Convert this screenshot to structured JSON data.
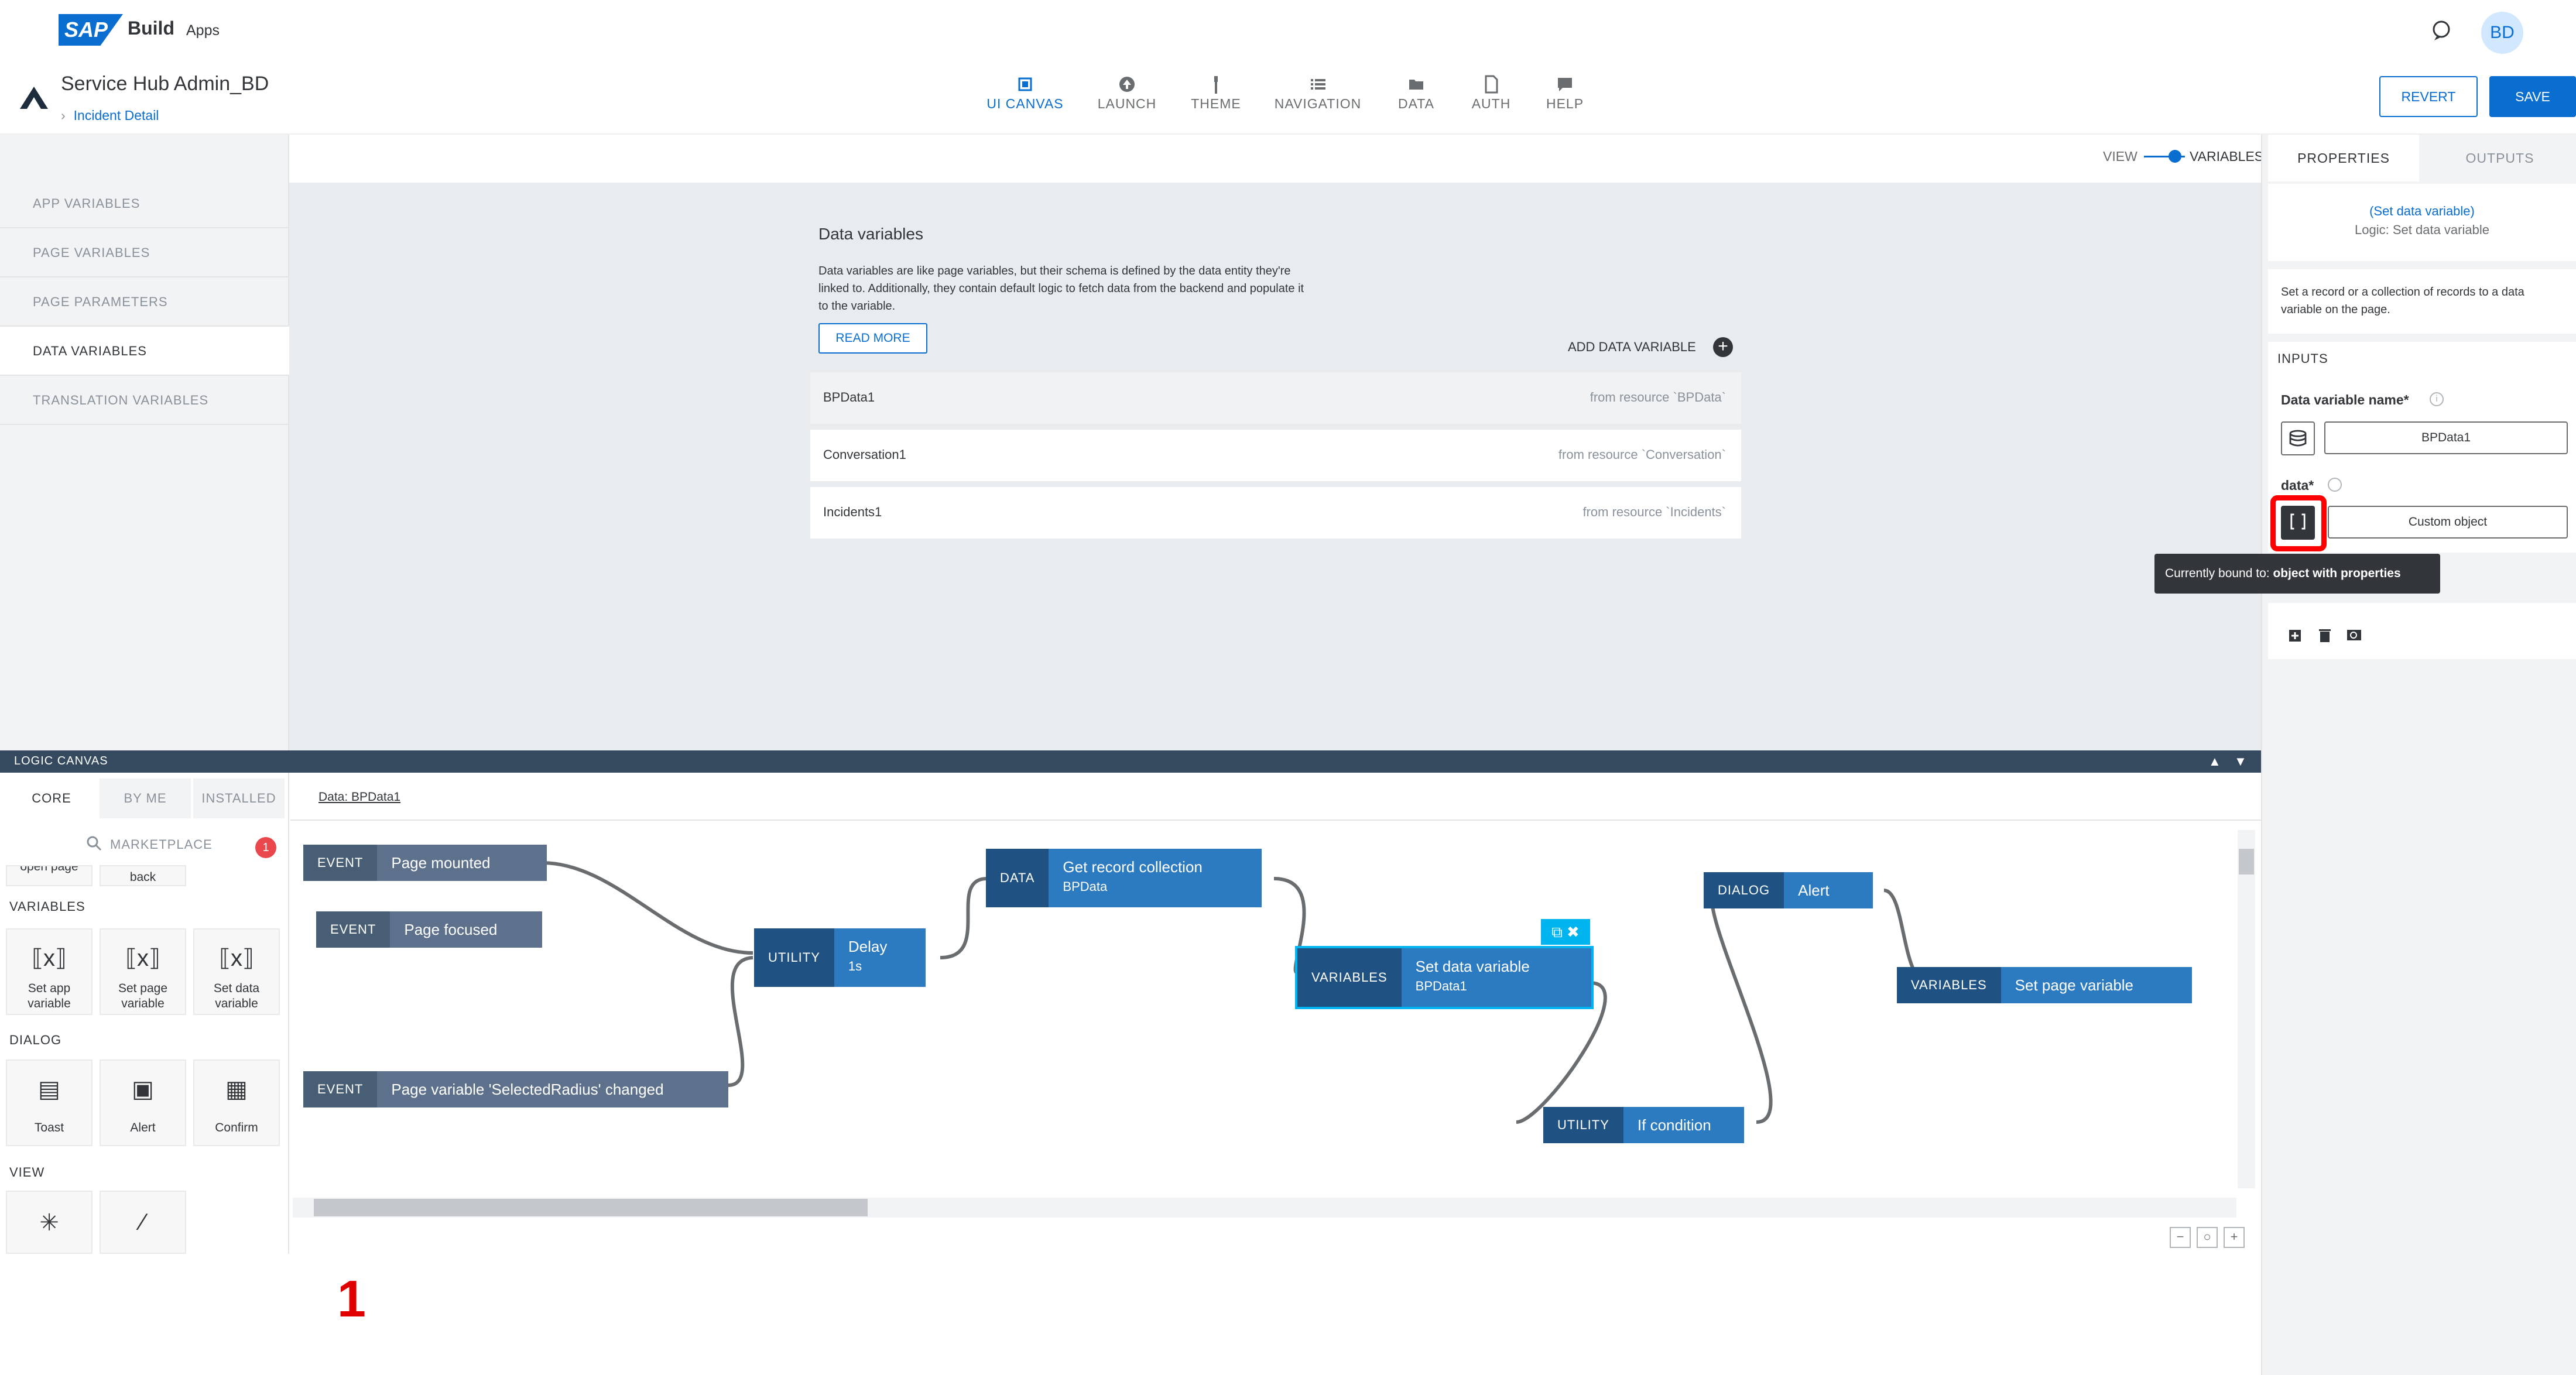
{
  "shell": {
    "brand_logo": "SAP",
    "brand_build": "Build",
    "brand_apps": "Apps",
    "avatar_initials": "BD"
  },
  "app": {
    "title": "Service Hub Admin_BD",
    "breadcrumb": "Incident Detail"
  },
  "nav_tabs": [
    {
      "label": "UI CANVAS",
      "icon": "canvas-icon",
      "active": true
    },
    {
      "label": "LAUNCH",
      "icon": "launch-icon"
    },
    {
      "label": "THEME",
      "icon": "brush-icon"
    },
    {
      "label": "NAVIGATION",
      "icon": "list-icon"
    },
    {
      "label": "DATA",
      "icon": "folder-icon"
    },
    {
      "label": "AUTH",
      "icon": "document-icon"
    },
    {
      "label": "HELP",
      "icon": "chat-icon"
    }
  ],
  "header_buttons": {
    "revert": "REVERT",
    "save": "SAVE"
  },
  "variable_sections": [
    {
      "label": "APP VARIABLES"
    },
    {
      "label": "PAGE VARIABLES"
    },
    {
      "label": "PAGE PARAMETERS"
    },
    {
      "label": "DATA VARIABLES",
      "active": true
    },
    {
      "label": "TRANSLATION VARIABLES"
    }
  ],
  "view_toggle": {
    "view": "VIEW",
    "variables": "VARIABLES"
  },
  "data_variables": {
    "title": "Data variables",
    "description": "Data variables are like page variables, but their schema is defined by the data entity they're linked to. Additionally, they contain default logic to fetch data from the backend and populate it to the variable.",
    "read_more": "READ MORE",
    "add_label": "ADD DATA VARIABLE",
    "rows": [
      {
        "name": "BPData1",
        "source": "from resource `BPData`"
      },
      {
        "name": "Conversation1",
        "source": "from resource `Conversation`"
      },
      {
        "name": "Incidents1",
        "source": "from resource `Incidents`"
      }
    ]
  },
  "properties": {
    "tab_properties": "PROPERTIES",
    "tab_outputs": "OUTPUTS",
    "link": "(Set data variable)",
    "subtitle": "Logic: Set data variable",
    "description": "Set a record or a collection of records to a data variable on the page.",
    "inputs_label": "INPUTS",
    "dv_name_label": "Data variable name*",
    "dv_name_value": "BPData1",
    "data_label": "data*",
    "data_value": "Custom object",
    "tooltip_prefix": "Currently bound to: ",
    "tooltip_bold": "object with properties"
  },
  "logic_canvas": {
    "title": "LOGIC CANVAS",
    "palette_tabs": [
      "CORE",
      "BY ME",
      "INSTALLED"
    ],
    "marketplace": "MARKETPLACE",
    "marketplace_badge": "1",
    "partial_cards": [
      "open page",
      "back"
    ],
    "sections": {
      "variables": "VARIABLES",
      "dialog": "DIALOG",
      "view": "VIEW"
    },
    "variable_cards": [
      "Set app variable",
      "Set page variable",
      "Set data variable"
    ],
    "dialog_cards": [
      "Toast",
      "Alert",
      "Confirm"
    ],
    "flow_tab": "Data: BPData1",
    "nodes": {
      "page_mounted": {
        "cat": "EVENT",
        "label": "Page mounted"
      },
      "page_focused": {
        "cat": "EVENT",
        "label": "Page focused"
      },
      "radius_changed": {
        "cat": "EVENT",
        "label": "Page variable 'SelectedRadius' changed"
      },
      "delay": {
        "cat": "UTILITY",
        "label": "Delay",
        "sub": "1s"
      },
      "get_records": {
        "cat": "DATA",
        "label": "Get record collection",
        "sub": "BPData"
      },
      "set_data_var": {
        "cat": "VARIABLES",
        "label": "Set data variable",
        "sub": "BPData1"
      },
      "if_condition": {
        "cat": "UTILITY",
        "label": "If condition"
      },
      "alert": {
        "cat": "DIALOG",
        "label": "Alert"
      },
      "set_page_var": {
        "cat": "VARIABLES",
        "label": "Set page variable"
      }
    }
  },
  "step_marker": "1",
  "colors": {
    "accent": "#0a6ed1",
    "highlight": "#ff0000",
    "logic_bar": "#354a5f"
  }
}
